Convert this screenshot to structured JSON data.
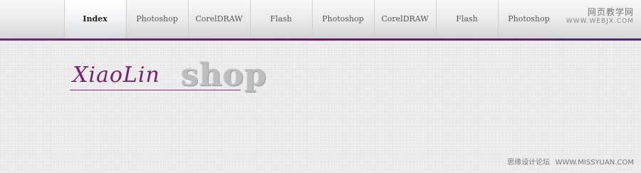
{
  "nav": {
    "items": [
      {
        "label": "Index",
        "active": true
      },
      {
        "label": "Photoshop",
        "active": false
      },
      {
        "label": "CorelDRAW",
        "active": false
      },
      {
        "label": "Flash",
        "active": false
      },
      {
        "label": "Photoshop",
        "active": false
      },
      {
        "label": "CorelDRAW",
        "active": false
      },
      {
        "label": "Flash",
        "active": false
      },
      {
        "label": "Photoshop",
        "active": false
      }
    ]
  },
  "watermark_top": {
    "text": "网页教学网",
    "url": "WWW.WEBJX.COM"
  },
  "logo": {
    "script": "XiaoLin",
    "word": "shop"
  },
  "watermark_bottom": {
    "text": "思缘设计论坛",
    "url": "WWW.MISSYUAN.COM"
  },
  "colors": {
    "accent": "#6a1c5a",
    "logo_script": "#7a1f6a",
    "logo_word": "#bdbdbd"
  }
}
